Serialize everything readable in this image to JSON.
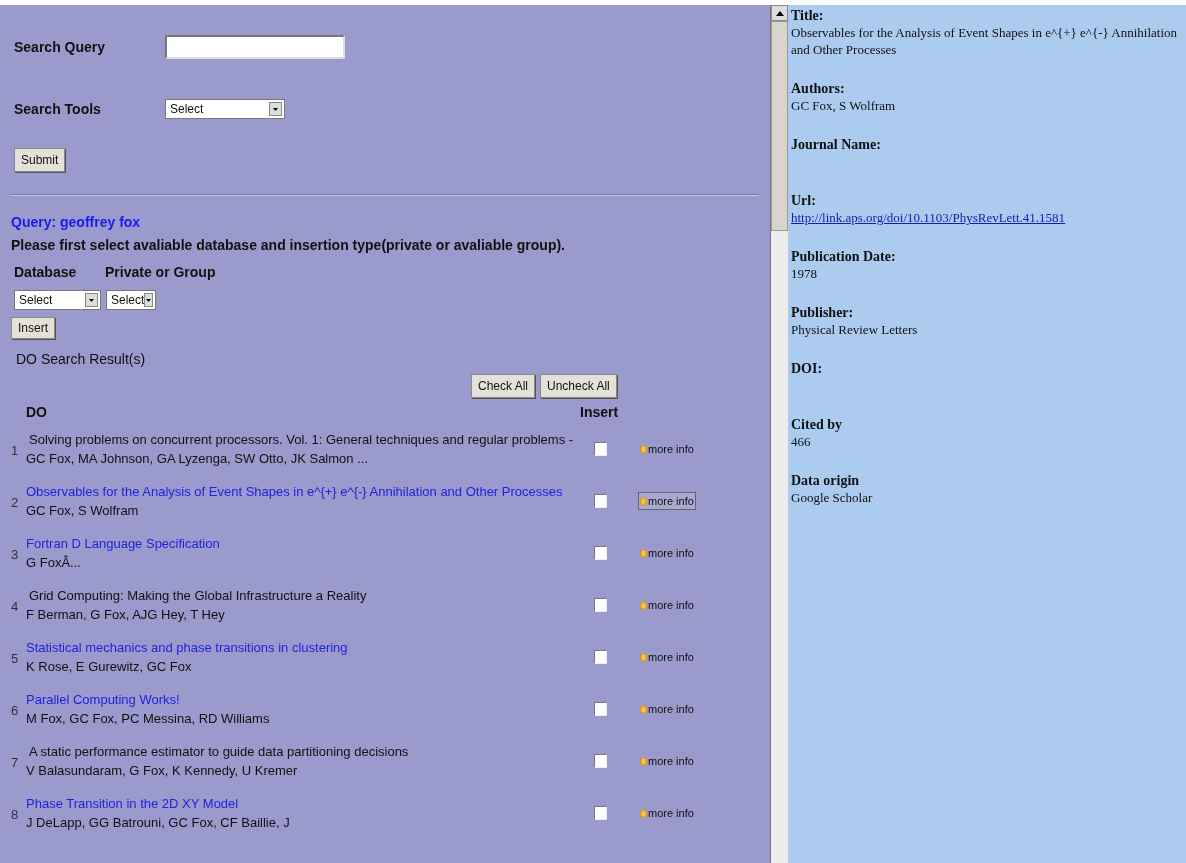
{
  "search_form": {
    "query_label": "Search Query",
    "tools_label": "Search Tools",
    "tools_select": "Select",
    "submit": "Submit"
  },
  "results": {
    "query": "Query: geoffrey fox",
    "instruction": "Please first select avaliable database and insertion type(private or avaliable group).",
    "database_label": "Database",
    "group_label": "Private or Group",
    "database_select": "Select",
    "group_select": "Select",
    "insert_button": "Insert",
    "result_heading": "DO Search Result(s)",
    "check_all": "Check All",
    "uncheck_all": "Uncheck All",
    "columns": [
      "DO",
      "Insert"
    ],
    "rows": [
      {
        "index": "1",
        "kind": "plain",
        "title": "Solving problems on concurrent processors. Vol. 1: General techniques and regular problems -",
        "authors": "GC Fox, MA Johnson, GA Lyzenga, SW Otto, JK Salmon ...",
        "checked": false,
        "more_info": "more info",
        "selected": false
      },
      {
        "index": "2",
        "kind": "link",
        "title": "Observables for the Analysis of Event Shapes in e^{+} e^{-} Annihilation and Other Processes",
        "authors": "GC Fox, S Wolfram",
        "checked": false,
        "more_info": "more info",
        "selected": true
      },
      {
        "index": "3",
        "kind": "link",
        "title": "Fortran D Language Specification",
        "authors": "G FoxÂ...",
        "checked": false,
        "more_info": "more info",
        "selected": false
      },
      {
        "index": "4",
        "kind": "plain",
        "title": "Grid Computing: Making the Global Infrastructure a Reality",
        "authors": "F Berman, G Fox, AJG Hey, T Hey",
        "checked": false,
        "more_info": "more info",
        "selected": false
      },
      {
        "index": "5",
        "kind": "link",
        "title": "Statistical mechanics and phase transitions in clustering",
        "authors": "K Rose, E Gurewitz, GC Fox",
        "checked": false,
        "more_info": "more info",
        "selected": false
      },
      {
        "index": "6",
        "kind": "link",
        "title": "Parallel Computing Works!",
        "authors": "M Fox, GC Fox, PC Messina, RD Williams",
        "checked": false,
        "more_info": "more info",
        "selected": false
      },
      {
        "index": "7",
        "kind": "plain",
        "title": "A static performance estimator to guide data partitioning decisions",
        "authors": "V Balasundaram, G Fox, K Kennedy, U Kremer",
        "checked": false,
        "more_info": "more info",
        "selected": false
      },
      {
        "index": "8",
        "kind": "link",
        "title": "Phase Transition in the 2D XY Model",
        "authors": "J DeLapp, GG Batrouni, GC Fox, CF Baillie, J",
        "checked": false,
        "more_info": "more info",
        "selected": false
      }
    ]
  },
  "details": [
    {
      "label": "Title:",
      "kind": "text",
      "value": "Observables for the Analysis of Event Shapes in e^{+} e^{-} Annihilation and Other Processes"
    },
    {
      "label": "Authors:",
      "kind": "text",
      "value": "GC Fox, S Wolfram"
    },
    {
      "label": "Journal Name:"
    },
    {
      "label": "Url:",
      "kind": "link",
      "value": "http://link.aps.org/doi/10.1103/PhysRevLett.41.1581"
    },
    {
      "label": "Publication Date:",
      "kind": "text",
      "value": "1978"
    },
    {
      "label": "Publisher:",
      "kind": "text",
      "value": "Physical Review Letters"
    },
    {
      "label": "DOI:"
    },
    {
      "label": "Cited by",
      "kind": "text",
      "value": "466"
    },
    {
      "label": "Data origin",
      "kind": "text",
      "value": "Google Scholar"
    }
  ]
}
